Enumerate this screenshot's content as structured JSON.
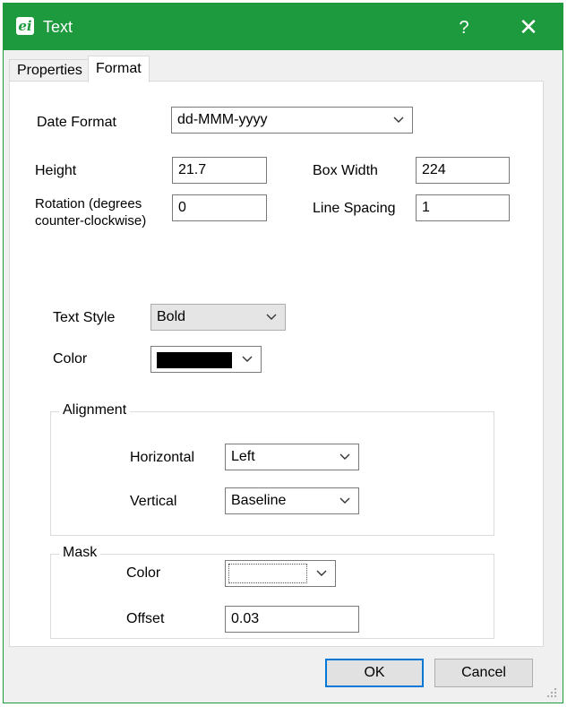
{
  "window": {
    "title": "Text",
    "app_icon_glyph": "ei",
    "help_label": "?",
    "close_label": "✕"
  },
  "tabs": [
    {
      "label": "Properties",
      "active": false
    },
    {
      "label": "Format",
      "active": true
    }
  ],
  "format": {
    "date_format_label": "Date Format",
    "date_format_value": "dd-MMM-yyyy",
    "height_label": "Height",
    "height_value": "21.7",
    "box_width_label": "Box Width",
    "box_width_value": "224",
    "rotation_label": "Rotation (degrees counter-clockwise)",
    "rotation_value": "0",
    "line_spacing_label": "Line Spacing",
    "line_spacing_value": "1",
    "text_style_label": "Text Style",
    "text_style_value": "Bold",
    "color_label": "Color",
    "color_value": "#000000"
  },
  "alignment": {
    "group_title": "Alignment",
    "horizontal_label": "Horizontal",
    "horizontal_value": "Left",
    "vertical_label": "Vertical",
    "vertical_value": "Baseline"
  },
  "mask": {
    "group_title": "Mask",
    "color_label": "Color",
    "color_value": "#ffffff",
    "offset_label": "Offset",
    "offset_value": "0.03"
  },
  "buttons": {
    "ok_label": "OK",
    "cancel_label": "Cancel"
  },
  "colors": {
    "titlebar": "#1e9a3e",
    "focus_border": "#0078d7"
  }
}
